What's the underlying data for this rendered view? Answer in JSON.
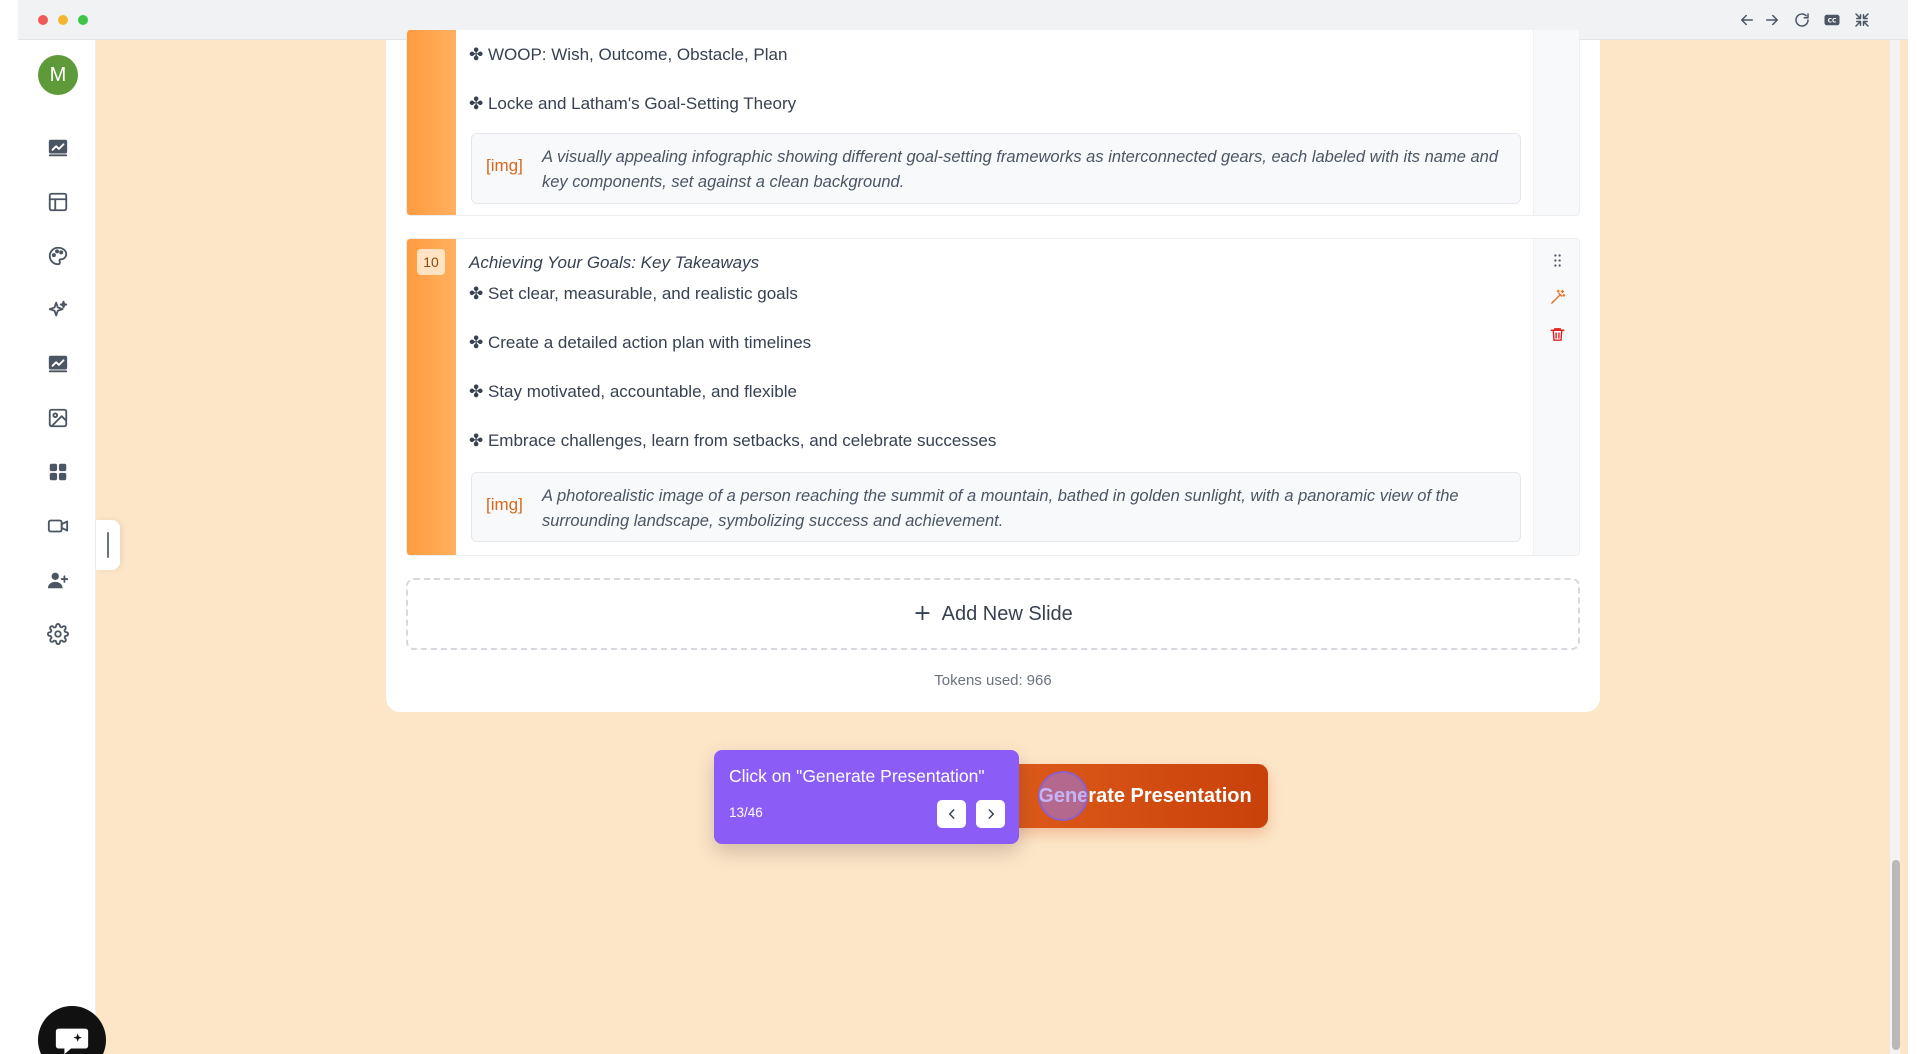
{
  "sidebar": {
    "avatar_initial": "M",
    "items": [
      {
        "icon": "presentation-chart-icon"
      },
      {
        "icon": "layout-icon"
      },
      {
        "icon": "palette-icon"
      },
      {
        "icon": "sparkles-icon"
      },
      {
        "icon": "presentation-chart-icon"
      },
      {
        "icon": "image-icon"
      },
      {
        "icon": "apps-icon"
      },
      {
        "icon": "video-icon"
      },
      {
        "icon": "add-user-icon"
      },
      {
        "icon": "gear-icon"
      }
    ]
  },
  "slides": [
    {
      "bullets": [
        "✤ WOOP: Wish, Outcome, Obstacle, Plan",
        "✤ Locke and Latham's Goal-Setting Theory"
      ],
      "image_tag": "[img]",
      "image_prompt": "A visually appealing infographic showing different goal-setting frameworks as interconnected gears, each labeled with its name and key components, set against a clean background."
    },
    {
      "number": "10",
      "title": "Achieving Your Goals: Key Takeaways",
      "bullets": [
        "✤ Set clear, measurable, and realistic goals",
        "✤ Create a detailed action plan with timelines",
        "✤ Stay motivated, accountable, and flexible",
        "✤ Embrace challenges, learn from setbacks, and celebrate successes"
      ],
      "image_tag": "[img]",
      "image_prompt": "A photorealistic image of a person reaching the summit of a mountain, bathed in golden sunlight, with a panoramic view of the surrounding landscape, symbolizing success and achievement."
    }
  ],
  "add_slide": {
    "plus": "+",
    "label": "Add New Slide"
  },
  "tokens": {
    "label": "Tokens used:",
    "value": "966"
  },
  "generate_button": {
    "label": "Generate Presentation"
  },
  "tour": {
    "title": "Click on \"Generate Presentation\"",
    "step": "13/46"
  },
  "colors": {
    "accent": "#df5d1c",
    "tour": "#8b5cf6",
    "background": "#fde6c8"
  }
}
